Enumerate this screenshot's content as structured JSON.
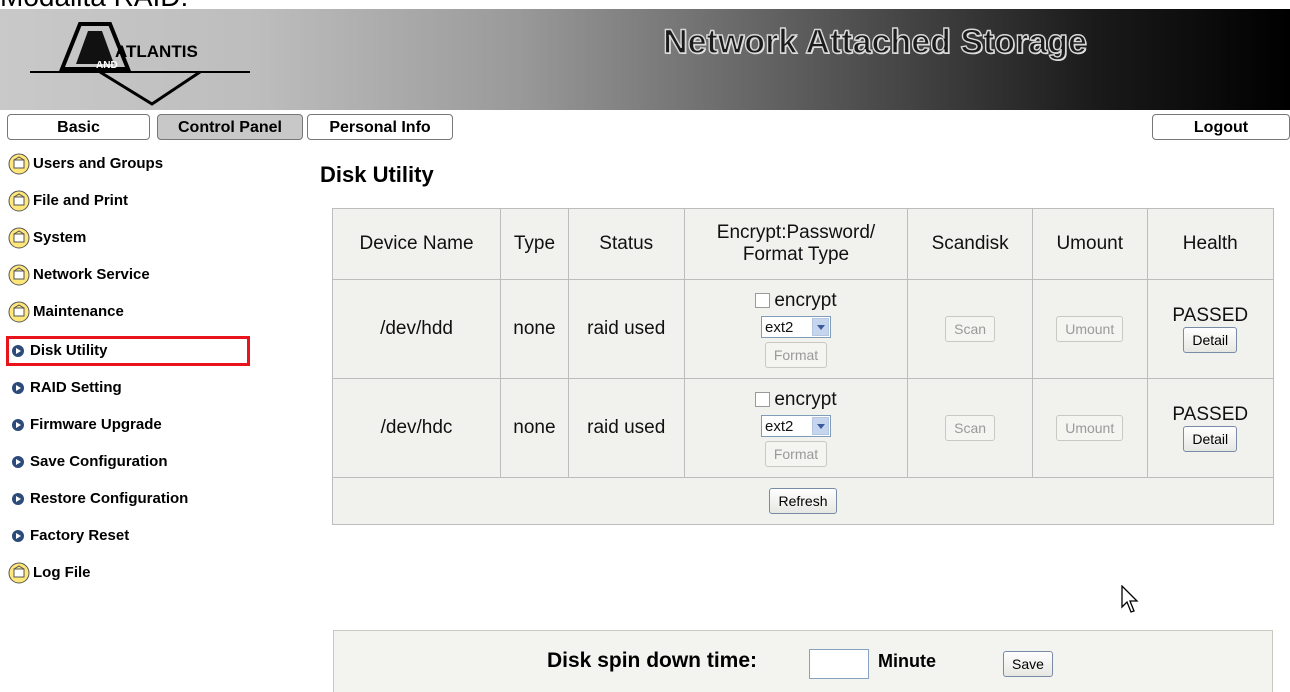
{
  "caption": "Modalità RAID:",
  "banner": {
    "logo_text": "ATLANTIS",
    "logo_sub": "AND",
    "title": "Network Attached Storage"
  },
  "tabs": {
    "basic": "Basic",
    "control_panel": "Control Panel",
    "personal_info": "Personal Info",
    "logout": "Logout"
  },
  "sidebar": {
    "items": [
      {
        "label": "Users and Groups",
        "icon": "folder-globe-icon"
      },
      {
        "label": "File and Print",
        "icon": "folder-globe-icon"
      },
      {
        "label": "System",
        "icon": "folder-globe-icon"
      },
      {
        "label": "Network Service",
        "icon": "folder-globe-icon"
      },
      {
        "label": "Maintenance",
        "icon": "folder-globe-icon"
      },
      {
        "label": "Disk Utility",
        "icon": "bullet-icon"
      },
      {
        "label": "RAID Setting",
        "icon": "bullet-icon"
      },
      {
        "label": "Firmware Upgrade",
        "icon": "bullet-icon"
      },
      {
        "label": "Save Configuration",
        "icon": "bullet-icon"
      },
      {
        "label": "Restore Configuration",
        "icon": "bullet-icon"
      },
      {
        "label": "Factory Reset",
        "icon": "bullet-icon"
      },
      {
        "label": "Log File",
        "icon": "folder-globe-icon"
      }
    ],
    "highlight_color": "#e8131b"
  },
  "main": {
    "title": "Disk Utility",
    "table": {
      "headers": [
        "Device Name",
        "Type",
        "Status",
        "Encrypt:Password/",
        "Format Type",
        "Scandisk",
        "Umount",
        "Health"
      ],
      "rows": [
        {
          "device": "/dev/hdd",
          "type": "none",
          "status": "raid used",
          "encrypt_label": "encrypt",
          "format_type": "ext2",
          "format_btn": "Format",
          "scan_btn": "Scan",
          "umount_btn": "Umount",
          "health": "PASSED",
          "detail_btn": "Detail"
        },
        {
          "device": "/dev/hdc",
          "type": "none",
          "status": "raid used",
          "encrypt_label": "encrypt",
          "format_type": "ext2",
          "format_btn": "Format",
          "scan_btn": "Scan",
          "umount_btn": "Umount",
          "health": "PASSED",
          "detail_btn": "Detail"
        }
      ],
      "refresh_btn": "Refresh"
    },
    "spin": {
      "label": "Disk spin down time:",
      "value": "",
      "unit": "Minute",
      "save_btn": "Save"
    }
  }
}
